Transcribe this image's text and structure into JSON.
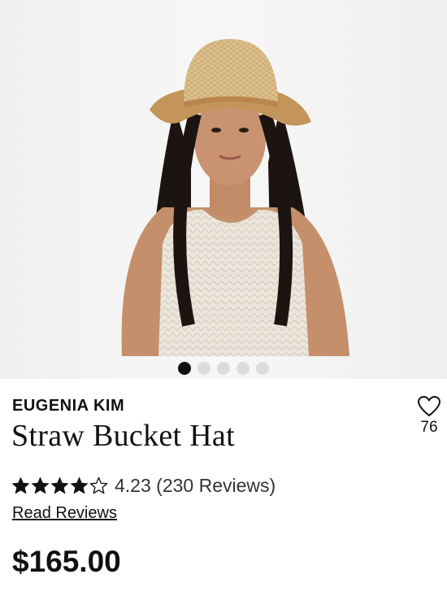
{
  "product": {
    "brand": "EUGENIA KIM",
    "title": "Straw Bucket Hat",
    "price": "$165.00",
    "favorites_count": "76",
    "rating_value": 4.23,
    "rating_text": "4.23 (230 Reviews)",
    "read_reviews_label": "Read Reviews"
  },
  "carousel": {
    "total_images": 5,
    "active_index": 0
  },
  "colors": {
    "text": "#111111",
    "dot_inactive": "#dcdcdc",
    "hero_bg": "#f4f4f4"
  },
  "icons": {
    "favorite": "heart-outline-icon",
    "star_full": "star-filled-icon",
    "star_empty": "star-outline-icon"
  }
}
